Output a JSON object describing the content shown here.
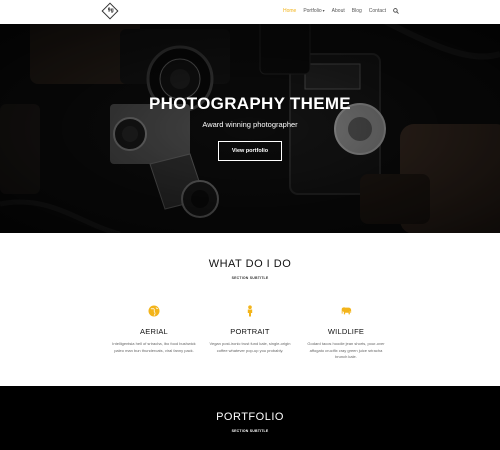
{
  "nav": {
    "logo_text": "9g",
    "items": [
      {
        "label": "Home",
        "active": true
      },
      {
        "label": "Portfolio",
        "has_dropdown": true
      },
      {
        "label": "About"
      },
      {
        "label": "Blog"
      },
      {
        "label": "Contact"
      }
    ],
    "accent_color": "#f3b41a",
    "search_icon": "search-icon"
  },
  "hero": {
    "title": "PHOTOGRAPHY THEME",
    "subtitle": "Award winning photographer",
    "button_label": "View portfolio",
    "background": "vintage cameras on dark surface"
  },
  "services": {
    "title": "WHAT DO I DO",
    "subtitle": "SECTION SUBTITLE",
    "items": [
      {
        "icon": "globe-icon",
        "name": "AERIAL",
        "text": "Intelligentsia hell of sriracha, ibo food bushwick paleo man bun thundercats, viral fanny pack."
      },
      {
        "icon": "person-icon",
        "name": "PORTRAIT",
        "text": "Vegan post-ironic trust fund kale, single-origin coffee whatever pop-up you probably."
      },
      {
        "icon": "elephant-icon",
        "name": "WILDLIFE",
        "text": "Godard tacos hoodie jean shorts, pour-over affogato crucifix cray green juice sriracha brunch kale."
      }
    ]
  },
  "portfolio": {
    "title": "PORTFOLIO",
    "subtitle": "SECTION SUBTITLE"
  }
}
